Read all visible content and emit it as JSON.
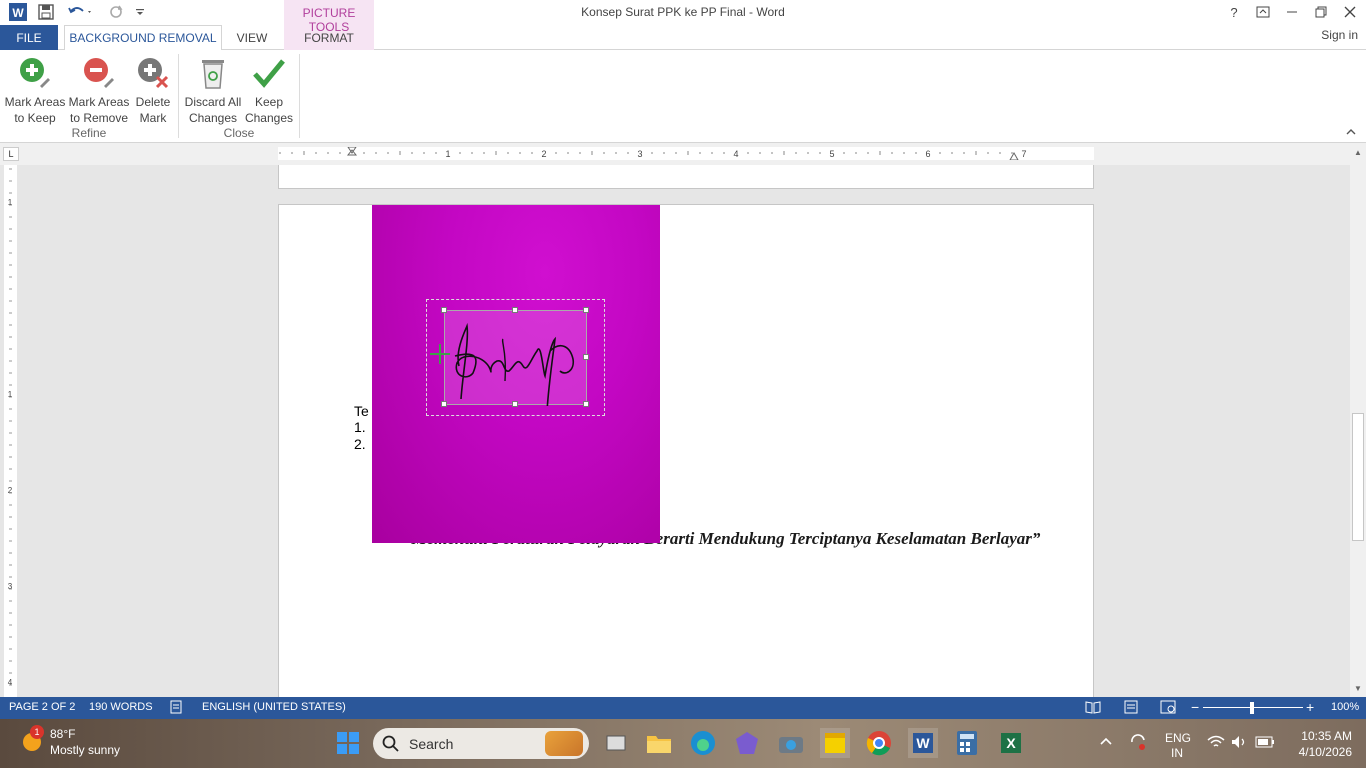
{
  "window": {
    "title": "Konsep Surat PPK ke PP Final - Word",
    "context_tab_group": "PICTURE TOOLS"
  },
  "tabs": {
    "file": "FILE",
    "background_removal": "BACKGROUND REMOVAL",
    "view": "VIEW",
    "format": "FORMAT",
    "sign_in": "Sign in"
  },
  "ribbon": {
    "refine": {
      "label": "Refine",
      "mark_keep_l1": "Mark Areas",
      "mark_keep_l2": "to Keep",
      "mark_remove_l1": "Mark Areas",
      "mark_remove_l2": "to Remove",
      "delete_l1": "Delete",
      "delete_l2": "Mark"
    },
    "close": {
      "label": "Close",
      "discard_l1": "Discard All",
      "discard_l2": "Changes",
      "keep_l1": "Keep",
      "keep_l2": "Changes"
    }
  },
  "ruler": {
    "numbers": [
      "1",
      "2",
      "3",
      "4",
      "5",
      "6",
      "7"
    ],
    "vnumbers": [
      "1",
      "1",
      "2",
      "3",
      "4"
    ]
  },
  "document": {
    "te_text": "Te",
    "list_1": "1.",
    "list_2": "2.",
    "motto": "“Memenuhi Peraturan Pelayaran Berarti Mendukung Terciptanya Keselamatan Berlayar”"
  },
  "statusbar": {
    "page": "PAGE 2 OF 2",
    "words": "190 WORDS",
    "language": "ENGLISH (UNITED STATES)",
    "zoom": "100%"
  },
  "taskbar": {
    "weather_badge": "1",
    "weather_temp": "88°F",
    "weather_desc": "Mostly sunny",
    "search_placeholder": "Search",
    "lang_1": "ENG",
    "lang_2": "IN",
    "time": "10:35 AM",
    "date": "4/10/2026"
  },
  "colors": {
    "word_blue": "#2b579a",
    "picture_tools_pink": "#b13f9c",
    "removal_magenta": "#c307c3"
  }
}
